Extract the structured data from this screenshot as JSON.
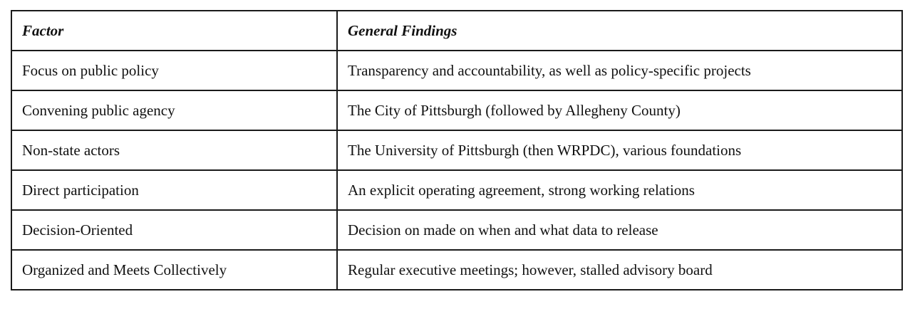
{
  "table": {
    "headers": [
      "Factor",
      "General Findings"
    ],
    "rows": [
      [
        "Focus on public policy",
        "Transparency and accountability, as well as policy-specific projects"
      ],
      [
        "Convening public agency",
        "The City of Pittsburgh (followed by Allegheny County)"
      ],
      [
        "Non-state actors",
        "The University of Pittsburgh (then WRPDC), various foundations"
      ],
      [
        "Direct participation",
        "An explicit operating agreement, strong working relations"
      ],
      [
        "Decision-Oriented",
        "Decision on made on when and what data to release"
      ],
      [
        "Organized and Meets Collectively",
        "Regular executive meetings; however, stalled advisory board"
      ]
    ]
  }
}
